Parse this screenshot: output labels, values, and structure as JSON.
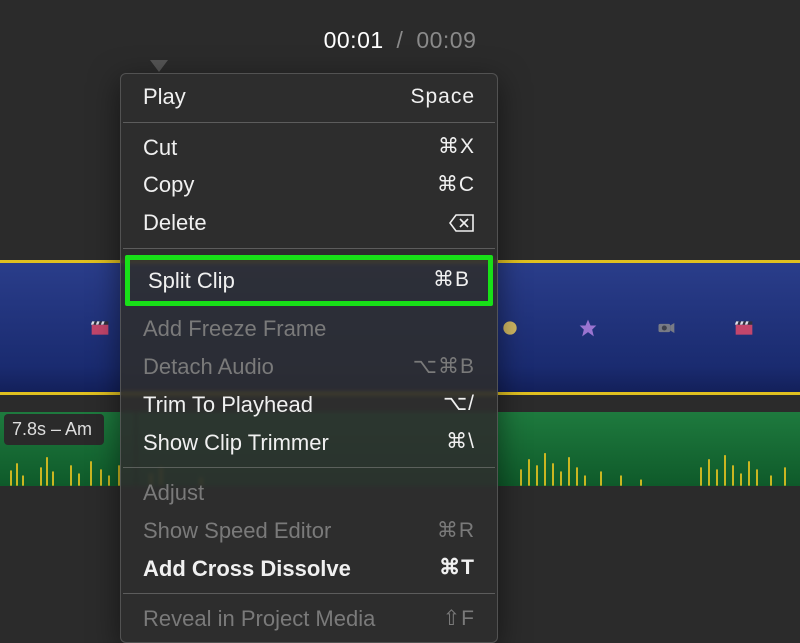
{
  "timecode": {
    "current": "00:01",
    "separator": "/",
    "total": "00:09"
  },
  "audio": {
    "label": "7.8s – Am"
  },
  "menu": {
    "play": {
      "label": "Play",
      "shortcut": "Space"
    },
    "cut": {
      "label": "Cut",
      "shortcut": "⌘X"
    },
    "copy": {
      "label": "Copy",
      "shortcut": "⌘C"
    },
    "delete": {
      "label": "Delete",
      "shortcut": ""
    },
    "split": {
      "label": "Split Clip",
      "shortcut": "⌘B"
    },
    "freeze": {
      "label": "Add Freeze Frame",
      "shortcut": ""
    },
    "detach": {
      "label": "Detach Audio",
      "shortcut": "⌥⌘B"
    },
    "trim": {
      "label": "Trim To Playhead",
      "shortcut": "⌥/"
    },
    "trimmer": {
      "label": "Show Clip Trimmer",
      "shortcut": "⌘\\"
    },
    "adjust": {
      "label": "Adjust",
      "shortcut": ""
    },
    "speed": {
      "label": "Show Speed Editor",
      "shortcut": "⌘R"
    },
    "dissolve": {
      "label": "Add Cross Dissolve",
      "shortcut": "⌘T"
    },
    "reveal": {
      "label": "Reveal in Project Media",
      "shortcut": "⇧F"
    }
  }
}
